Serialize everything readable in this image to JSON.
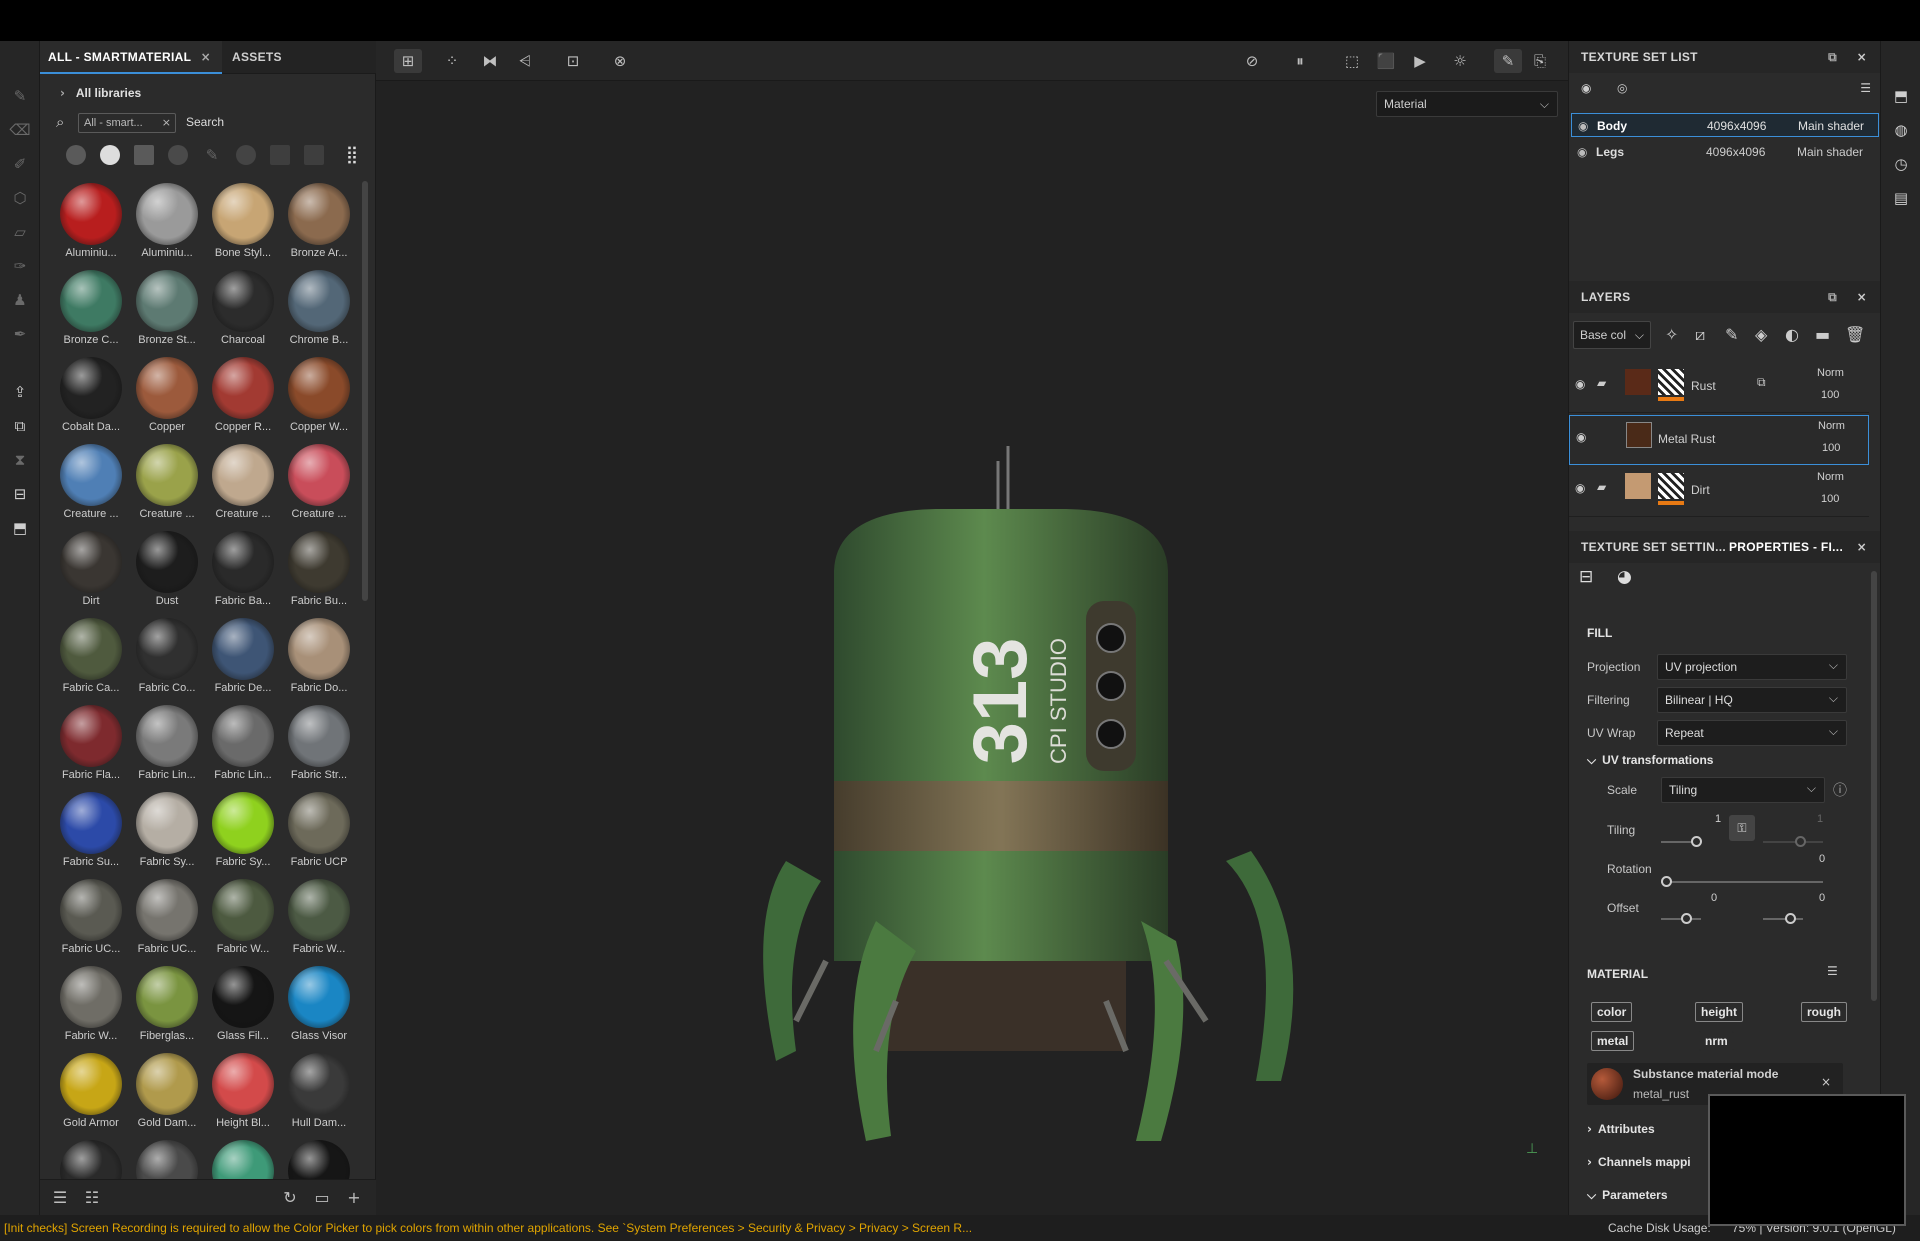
{
  "shelf": {
    "tabs": [
      "ALL - SMARTMATERIAL",
      "ASSETS"
    ],
    "breadcrumb": "All libraries",
    "filter_chip": "All - smart...",
    "search_placeholder": "Search",
    "materials": [
      {
        "label": "Aluminiu...",
        "color": "#b81e1e"
      },
      {
        "label": "Aluminiu...",
        "color": "#9a9a9a"
      },
      {
        "label": "Bone Styl...",
        "color": "#c7a574"
      },
      {
        "label": "Bronze Ar...",
        "color": "#8b6a4e"
      },
      {
        "label": "Bronze C...",
        "color": "#3e7a63"
      },
      {
        "label": "Bronze St...",
        "color": "#5d7a72"
      },
      {
        "label": "Charcoal",
        "color": "#2c2c2c"
      },
      {
        "label": "Chrome B...",
        "color": "#536777"
      },
      {
        "label": "Cobalt Da...",
        "color": "#222"
      },
      {
        "label": "Copper",
        "color": "#9c5a3c"
      },
      {
        "label": "Copper R...",
        "color": "#a23a32"
      },
      {
        "label": "Copper W...",
        "color": "#8a4a2a"
      },
      {
        "label": "Creature ...",
        "color": "#4f7fb5"
      },
      {
        "label": "Creature ...",
        "color": "#9aa24a"
      },
      {
        "label": "Creature ...",
        "color": "#bfa88e"
      },
      {
        "label": "Creature ...",
        "color": "#c94d5a"
      },
      {
        "label": "Dirt",
        "color": "#3a3632"
      },
      {
        "label": "Dust",
        "color": "#1d1d1d"
      },
      {
        "label": "Fabric Ba...",
        "color": "#2a2a2a"
      },
      {
        "label": "Fabric Bu...",
        "color": "#3e3a30"
      },
      {
        "label": "Fabric Ca...",
        "color": "#4f5a3e"
      },
      {
        "label": "Fabric Co...",
        "color": "#303030"
      },
      {
        "label": "Fabric De...",
        "color": "#3e5575"
      },
      {
        "label": "Fabric Do...",
        "color": "#a89078"
      },
      {
        "label": "Fabric Fla...",
        "color": "#7e2a2e"
      },
      {
        "label": "Fabric Lin...",
        "color": "#7a7a7a"
      },
      {
        "label": "Fabric Lin...",
        "color": "#6a6a6a"
      },
      {
        "label": "Fabric Str...",
        "color": "#707478"
      },
      {
        "label": "Fabric Su...",
        "color": "#2c4aa8"
      },
      {
        "label": "Fabric Sy...",
        "color": "#b5aea4"
      },
      {
        "label": "Fabric Sy...",
        "color": "#8fd11e"
      },
      {
        "label": "Fabric UCP",
        "color": "#6d6a5a"
      },
      {
        "label": "Fabric UC...",
        "color": "#5a5a52"
      },
      {
        "label": "Fabric UC...",
        "color": "#76746e"
      },
      {
        "label": "Fabric W...",
        "color": "#4d5a40"
      },
      {
        "label": "Fabric W...",
        "color": "#4c5a44"
      },
      {
        "label": "Fabric W...",
        "color": "#6f6d66"
      },
      {
        "label": "Fiberglas...",
        "color": "#7a9440"
      },
      {
        "label": "Glass Fil...",
        "color": "#151515"
      },
      {
        "label": "Glass Visor",
        "color": "#1a86c4"
      },
      {
        "label": "Gold Armor",
        "color": "#c7a616"
      },
      {
        "label": "Gold Dam...",
        "color": "#b09a4c"
      },
      {
        "label": "Height Bl...",
        "color": "#d34a4a"
      },
      {
        "label": "Hull Dam...",
        "color": "#3a3a3a"
      },
      {
        "label": "",
        "color": "#2a2a2a"
      },
      {
        "label": "",
        "color": "#4a4a4a"
      },
      {
        "label": "",
        "color": "#3e9a78"
      },
      {
        "label": "",
        "color": "#161616"
      }
    ]
  },
  "viewport": {
    "channel_select": "Material",
    "model_text_large": "313",
    "model_text_small": "CPI STUDIO"
  },
  "texture_set_list": {
    "title": "TEXTURE SET LIST",
    "rows": [
      {
        "name": "Body",
        "size": "4096x4096",
        "shader": "Main shader"
      },
      {
        "name": "Legs",
        "size": "4096x4096",
        "shader": "Main shader"
      }
    ]
  },
  "layers": {
    "title": "LAYERS",
    "channel": "Base col",
    "rows": [
      {
        "name": "Rust",
        "blend": "Norm",
        "opacity": "100"
      },
      {
        "name": "Metal Rust",
        "blend": "Norm",
        "opacity": "100"
      },
      {
        "name": "Dirt",
        "blend": "Norm",
        "opacity": "100"
      }
    ]
  },
  "properties": {
    "tabs": [
      "TEXTURE SET SETTIN...",
      "PROPERTIES - FI..."
    ],
    "fill_title": "FILL",
    "projection_label": "Projection",
    "projection_value": "UV projection",
    "filtering_label": "Filtering",
    "filtering_value": "Bilinear | HQ",
    "uvwrap_label": "UV Wrap",
    "uvwrap_value": "Repeat",
    "uvtrans_title": "UV transformations",
    "scale_label": "Scale",
    "scale_value": "Tiling",
    "tiling_label": "Tiling",
    "tiling_a": "1",
    "tiling_b": "1",
    "rotation_label": "Rotation",
    "rotation_value": "0",
    "offset_label": "Offset",
    "offset_a": "0",
    "offset_b": "0",
    "material_title": "MATERIAL",
    "channels": [
      "color",
      "height",
      "rough",
      "metal",
      "nrm"
    ],
    "substance_mode": "Substance material mode",
    "substance_name": "metal_rust",
    "attributes": "Attributes",
    "channels_mapping": "Channels mappi",
    "parameters": "Parameters"
  },
  "status": {
    "message": "[Init checks] Screen Recording is required to allow the Color Picker to pick colors from within other applications. See `System Preferences > Security & Privacy > Privacy > Screen R...",
    "cache": "Cache Disk Usage:",
    "version": "75% | Version: 9.0.1 (OpenGL)"
  }
}
